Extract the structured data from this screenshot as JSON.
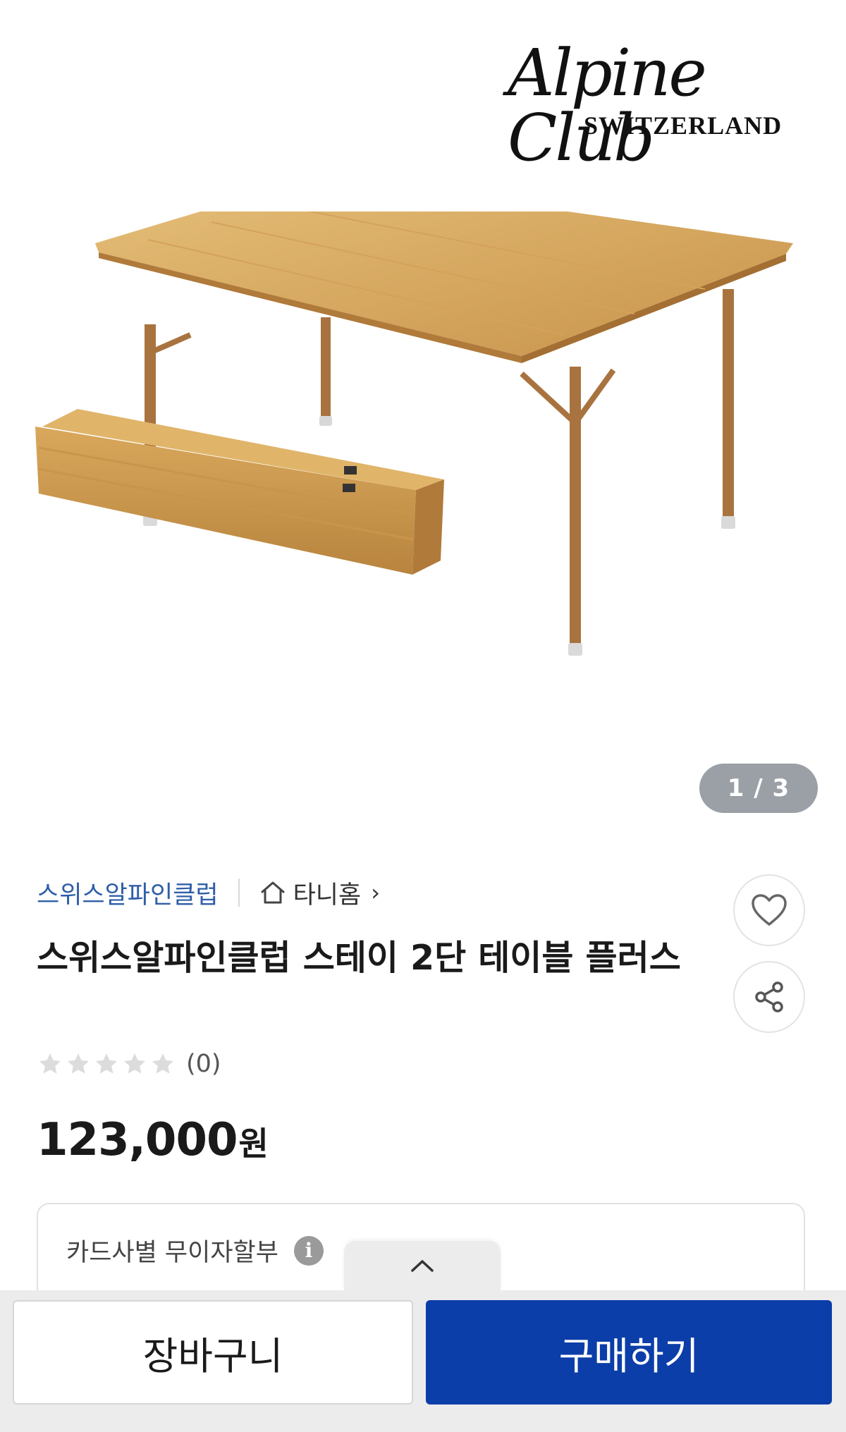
{
  "brand": {
    "logo_script": "Alpine Club",
    "logo_sub": "SWITZERLAND"
  },
  "gallery": {
    "pager": "1 / 3"
  },
  "seller": {
    "name": "스위스알파인클럽",
    "home_label": "타니홈",
    "home_icon": "home-icon",
    "chevron_icon": "chevron-right-icon"
  },
  "product": {
    "title": "스위스알파인클럽 스테이 2단 테이블 플러스",
    "rating_stars": 0,
    "review_count": "(0)",
    "price": "123,000",
    "price_unit": "원"
  },
  "actions": {
    "like_icon": "heart-icon",
    "share_icon": "share-icon"
  },
  "installment": {
    "label": "카드사별 무이자할부",
    "info_icon": "i"
  },
  "bottom_bar": {
    "cart_label": "장바구니",
    "buy_label": "구매하기",
    "expand_icon": "chevron-up-icon"
  },
  "colors": {
    "accent_blue": "#0b3ea8",
    "seller_link": "#2f5ea8",
    "badge_gray": "#9aa0a6"
  }
}
